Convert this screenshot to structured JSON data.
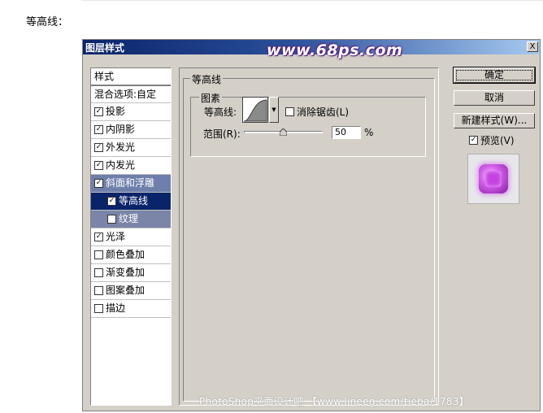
{
  "page": {
    "caption": "等高线："
  },
  "dialog": {
    "title": "图层样式",
    "watermark": "www.68ps.com",
    "close_label": "X",
    "footer_watermark": "PhotoShop平面设计吧 【www.lineeg.com/tieba/1783】"
  },
  "style_list": {
    "header": "样式",
    "blend_options": "混合选项:自定",
    "items": [
      {
        "label": "投影",
        "checked": true
      },
      {
        "label": "内阴影",
        "checked": true
      },
      {
        "label": "外发光",
        "checked": true
      },
      {
        "label": "内发光",
        "checked": true
      },
      {
        "label": "斜面和浮雕",
        "checked": true
      },
      {
        "label": "等高线",
        "checked": true
      },
      {
        "label": "纹理",
        "checked": false
      },
      {
        "label": "光泽",
        "checked": true
      },
      {
        "label": "颜色叠加",
        "checked": false
      },
      {
        "label": "渐变叠加",
        "checked": false
      },
      {
        "label": "图案叠加",
        "checked": false
      },
      {
        "label": "描边",
        "checked": false
      }
    ]
  },
  "contour_panel": {
    "outer_legend": "等高线",
    "inner_legend": "图素",
    "contour_label": "等高线:",
    "antialias_label": "消除锯齿(L)",
    "antialias_checked": false,
    "range_label": "范围(R):",
    "range_value": "50",
    "range_unit": "%",
    "range_fraction": 0.5
  },
  "buttons": {
    "ok": "确定",
    "cancel": "取消",
    "new_style": "新建样式(W)...",
    "preview_label": "预览(V)",
    "preview_checked": true
  },
  "colors": {
    "title_bar_start": "#0a246a",
    "selected_item": "#0a246a",
    "preview_gem": "#c443e0"
  }
}
